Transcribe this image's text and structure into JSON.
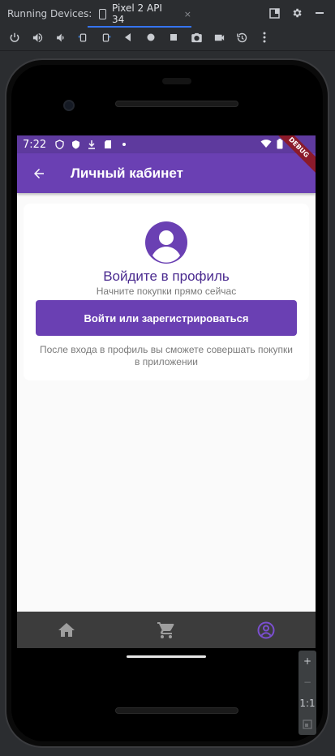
{
  "ide": {
    "running_label": "Running Devices:",
    "device_tab": "Pixel 2 API 34",
    "close_icon": "×"
  },
  "statusbar": {
    "time": "7:22"
  },
  "appbar": {
    "title": "Личный кабинет",
    "debug_label": "DEBUG"
  },
  "profile": {
    "heading": "Войдите в профиль",
    "subheading": "Начните покупки прямо сейчас",
    "login_button": "Войти или зарегистрироваться",
    "note": "После входа в профиль вы сможете совершать покупки в приложении"
  },
  "side_controls": {
    "zoom_in": "+",
    "zoom_out": "−",
    "one_to_one": "1:1"
  },
  "colors": {
    "accent": "#6a40b3",
    "status_bar": "#5e3a9e",
    "nav_bar": "#3c3c3c",
    "nav_active": "#7b4fd0",
    "nav_inactive": "#9e9e9e"
  },
  "nav": {
    "items": [
      {
        "icon": "home-icon",
        "active": false
      },
      {
        "icon": "cart-icon",
        "active": false
      },
      {
        "icon": "account-icon",
        "active": true
      }
    ]
  }
}
